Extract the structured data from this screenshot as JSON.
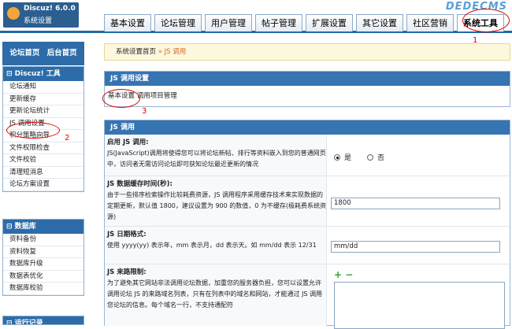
{
  "logo": {
    "line1": "Discuz! 6.0.0",
    "line2": "系统设置"
  },
  "watermark": "DEDECMS",
  "tabs": [
    "基本设置",
    "论坛管理",
    "用户管理",
    "帖子管理",
    "扩展设置",
    "其它设置",
    "社区营销",
    "系统工具"
  ],
  "sidebar": {
    "quicklinks": [
      "论坛首页",
      "后台首页"
    ],
    "discuz_tools": {
      "title": "⊟ Discuz! 工具",
      "items": [
        "论坛通知",
        "更新缓存",
        "更新论坛统计",
        "JS 调用设置",
        "积分策略向导",
        "文件权限检查",
        "文件校验",
        "清理短消息",
        "论坛方案设置"
      ]
    },
    "database": {
      "title": "⊟ 数据库",
      "items": [
        "资料备份",
        "资料恢复",
        "数据库升级",
        "数据表优化",
        "数据库校验"
      ]
    },
    "logs_title": "⊟ 运行记录"
  },
  "breadcrumb": {
    "home": "系统设置首页",
    "sep": " » ",
    "current": "JS 调用"
  },
  "js_settings": {
    "title": "JS 调用设置",
    "subnav": [
      "基本设置",
      "调用项目管理"
    ]
  },
  "js_panel": {
    "title": "JS 调用",
    "rows": {
      "enable": {
        "label": "启用  JS 调用:",
        "text": "JS(JavaScript)调用将使得您可以将论坛新帖、排行等资料嵌入到您的普通网页中，访问者无需访问论坛即可获知论坛最近更新的情况",
        "yes": "是",
        "no": "否"
      },
      "cache": {
        "label": "JS 数据缓存时间(秒):",
        "text": "由于一些排序检索操作比较耗费资源，JS 调用程序采用缓存技术来实现数据的定期更新，默认值 1800，建议设置为 900 的数值，0 为不缓存(极耗费系统资源)",
        "value": "1800"
      },
      "date": {
        "label": "JS 日期格式:",
        "text": "使用  yyyy(yy) 表示年，mm 表示月，dd 表示天。如  mm/dd 表示 12/31",
        "value": "mm/dd"
      },
      "referer": {
        "label": "JS 来路限制:",
        "text": "为了避免其它网站非法调用论坛数据，加重您的服务器负担，您可以设置允许调用论坛 JS 的来路域名列表，只有在列表中的域名和网站，才能通过 JS 调用您论坛的信息。每个域名一行，不支持通配符"
      }
    }
  },
  "annotations": [
    "1",
    "2",
    "3"
  ],
  "colors": {
    "header_blue": "#3674b2",
    "annotation_red": "#dd0000",
    "breadcrumb_bg": "#fdf7de"
  }
}
